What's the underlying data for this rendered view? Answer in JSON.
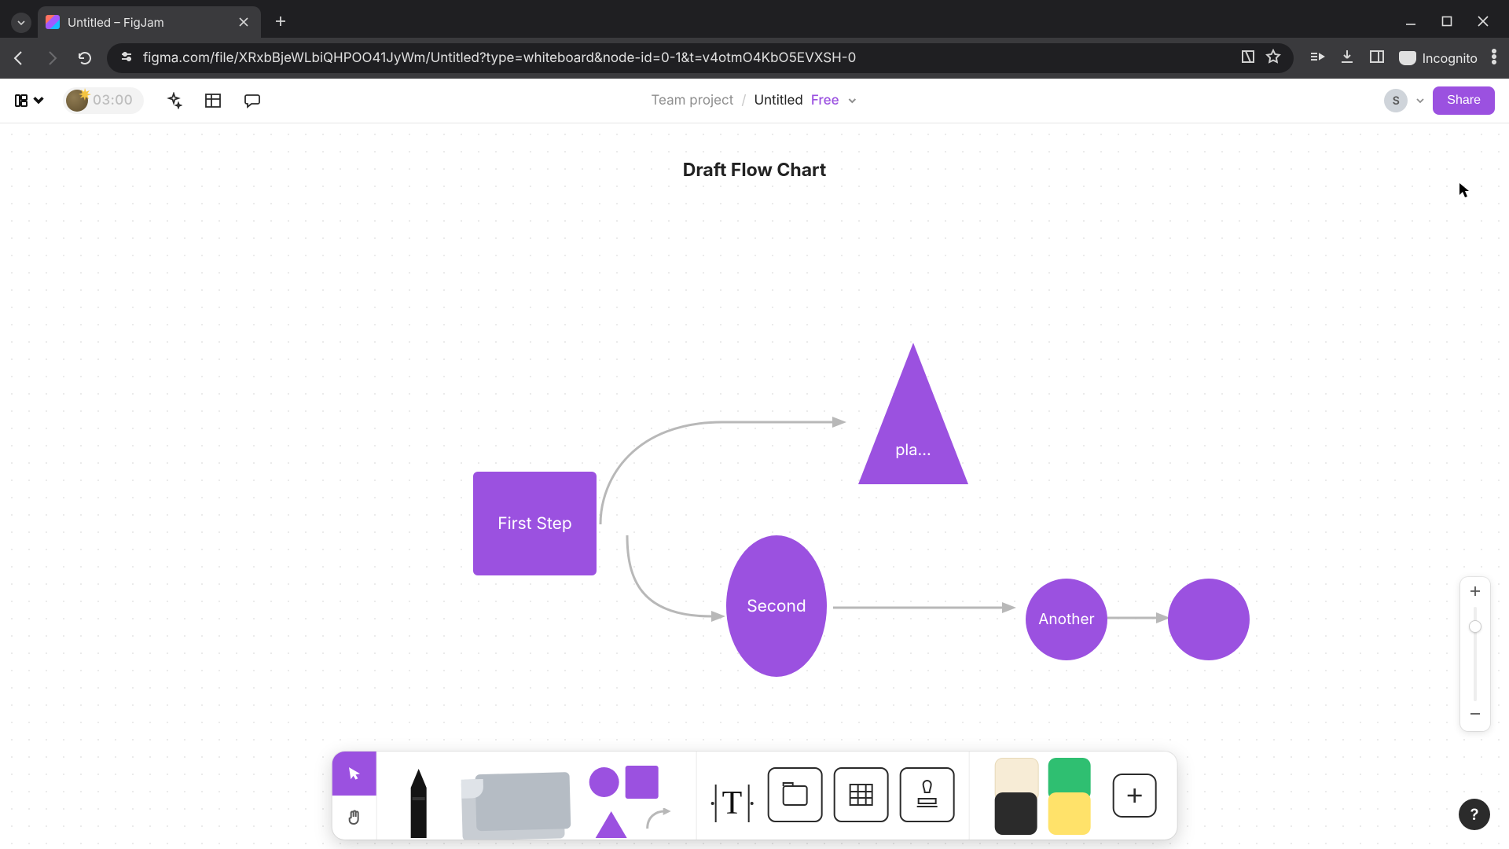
{
  "browser": {
    "tab_title": "Untitled – FigJam",
    "url": "figma.com/file/XRxbBjeWLbiQHPOO41JyWm/Untitled?type=whiteboard&node-id=0-1&t=v4otmO4KbO5EVXSH-0",
    "incognito_label": "Incognito"
  },
  "header": {
    "timer": "03:00",
    "team_label": "Team project",
    "file_name": "Untitled",
    "plan_badge": "Free",
    "avatar_initial": "S",
    "share_label": "Share"
  },
  "canvas": {
    "title": "Draft Flow Chart",
    "shapes": {
      "rect": "First Step",
      "triangle": "pla...",
      "oval": "Second",
      "circle1": "Another",
      "circle2": ""
    },
    "accent": "#9b51e0"
  },
  "help_label": "?"
}
